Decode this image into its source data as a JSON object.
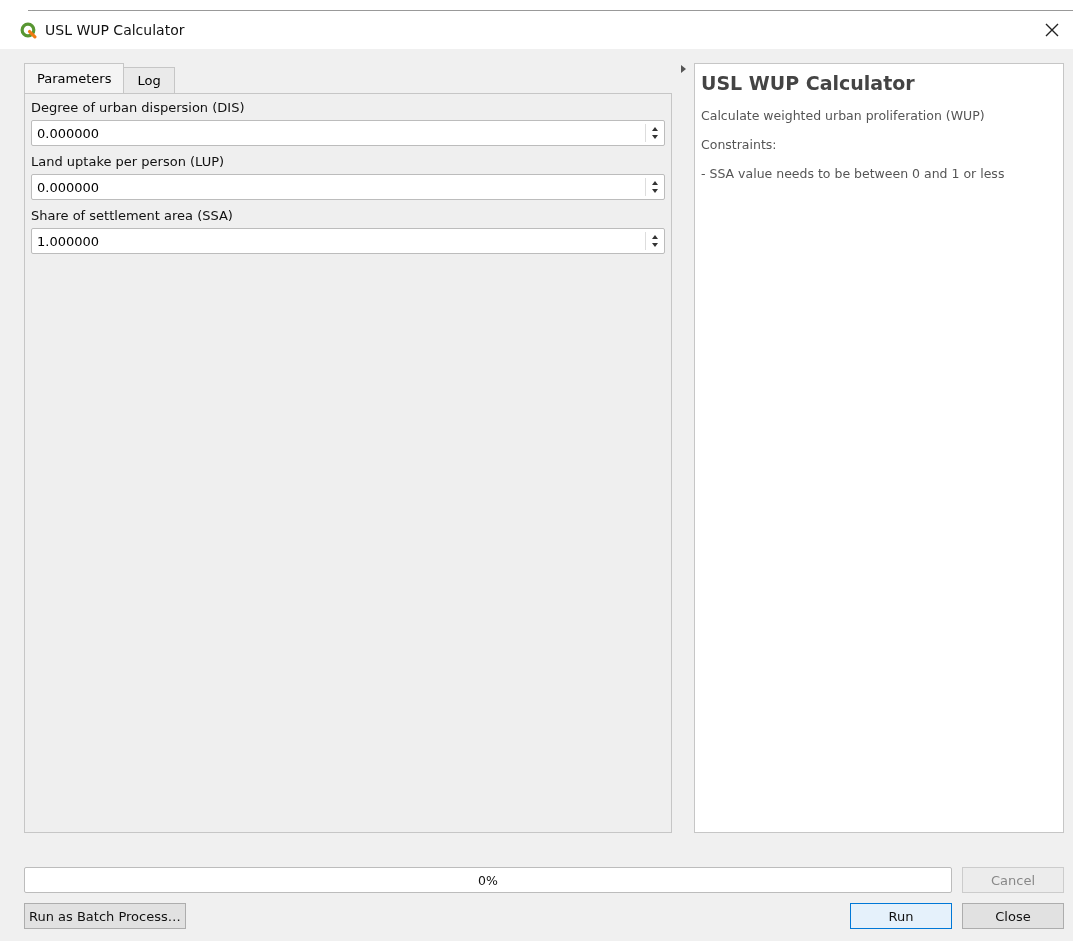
{
  "window": {
    "title": "USL WUP Calculator"
  },
  "tabs": [
    {
      "label": "Parameters",
      "selected": true
    },
    {
      "label": "Log",
      "selected": false
    }
  ],
  "parameters": [
    {
      "label": "Degree of urban dispersion (DIS)",
      "value": "0.000000"
    },
    {
      "label": "Land uptake per person (LUP)",
      "value": "0.000000"
    },
    {
      "label": "Share of settlement area (SSA)",
      "value": "1.000000"
    }
  ],
  "help": {
    "title": "USL WUP Calculator",
    "paragraphs": [
      "Calculate weighted urban proliferation (WUP)",
      "Constraints:",
      "- SSA value needs to be between 0 and 1 or less"
    ]
  },
  "progress": {
    "level": 0,
    "text": "0%"
  },
  "buttons": [
    {
      "label": "Cancel",
      "disabled": true,
      "default": false
    },
    {
      "label": "Run as Batch Process…",
      "disabled": false,
      "default": false
    },
    {
      "label": "Run",
      "disabled": false,
      "default": true
    },
    {
      "label": "Close",
      "disabled": false,
      "default": false
    }
  ]
}
